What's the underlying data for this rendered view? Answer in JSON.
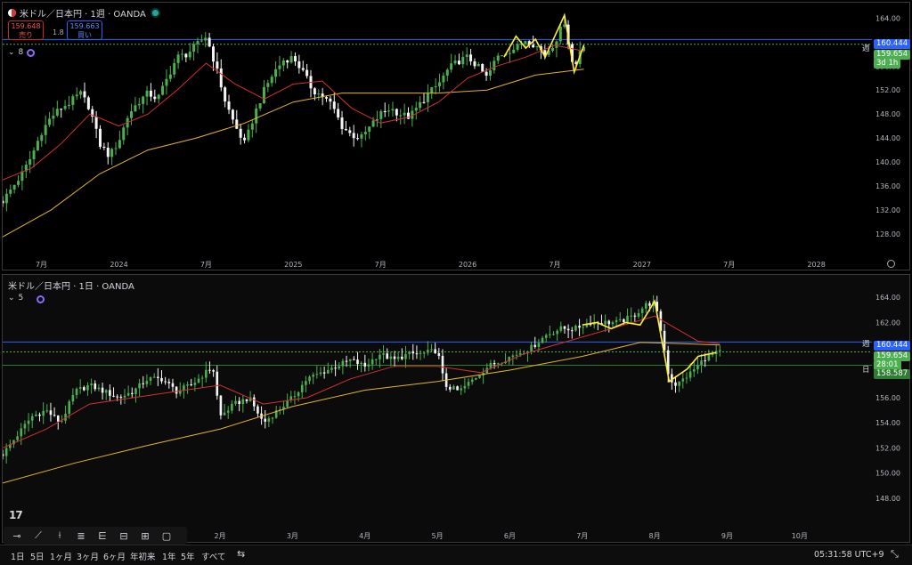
{
  "top_panel": {
    "title": "米ドル／日本円 · 1週 · OANDA",
    "sell_price": "159.648",
    "sell_label": "売り",
    "buy_price": "159.663",
    "buy_label": "買い",
    "spread": "1.8",
    "indicator_count": "8",
    "weekly_level_tag": "週",
    "weekly_level": "160.444",
    "current_price": "159.654",
    "countdown": "3d 1h"
  },
  "bottom_panel": {
    "title": "米ドル／日本円 · 1日 · OANDA",
    "indicator_count": "5",
    "weekly_level_tag": "週",
    "weekly_level": "160.444",
    "current_price": "159.654",
    "countdown": "28:01",
    "daily_level_tag": "日",
    "daily_level": "158.587"
  },
  "bottom_bar": {
    "timeframes": [
      "1日",
      "5日",
      "1ヶ月",
      "3ヶ月",
      "6ヶ月",
      "年初来",
      "1年",
      "5年",
      "すべて"
    ],
    "clock": "05:31:58 UTC+9"
  },
  "tools": [
    "cursor-line",
    "trend-line",
    "vertical-line",
    "fib-retracement",
    "fib-extension",
    "fib-channel",
    "grid",
    "rectangle"
  ],
  "colors": {
    "up": "#4caf50",
    "down": "#f5f5f5",
    "ma_fast": "#d32f2f",
    "ma_slow": "#e6b422",
    "level": "#2962ff",
    "zigzag": "#ffeb3b",
    "price_tag": "#4caf50"
  },
  "chart_data": [
    {
      "type": "candlestick",
      "title": "米ドル／日本円 · 1週 · OANDA",
      "ylim": [
        125,
        166
      ],
      "y_ticks": [
        128,
        132,
        136,
        140,
        144,
        148,
        152,
        156,
        160,
        164
      ],
      "x_ticks": [
        {
          "label": "7月",
          "t": 0.08
        },
        {
          "label": "2024",
          "t": 0.24
        },
        {
          "label": "7月",
          "t": 0.42
        },
        {
          "label": "2025",
          "t": 0.6
        },
        {
          "label": "7月",
          "t": 0.78
        },
        {
          "label": "2026",
          "t": 0.96
        },
        {
          "label": "7月",
          "t": 1.14
        },
        {
          "label": "2027",
          "t": 1.32
        },
        {
          "label": "7月",
          "t": 1.5
        },
        {
          "label": "2028",
          "t": 1.68
        }
      ],
      "t_range": [
        0,
        1.78
      ],
      "close_path": [
        [
          0.0,
          133.5
        ],
        [
          0.04,
          138
        ],
        [
          0.06,
          141
        ],
        [
          0.08,
          145
        ],
        [
          0.1,
          147.5
        ],
        [
          0.12,
          149
        ],
        [
          0.14,
          150
        ],
        [
          0.16,
          151.5
        ],
        [
          0.18,
          149
        ],
        [
          0.2,
          143
        ],
        [
          0.22,
          141
        ],
        [
          0.24,
          143.5
        ],
        [
          0.26,
          148
        ],
        [
          0.28,
          150
        ],
        [
          0.3,
          151.5
        ],
        [
          0.32,
          150.5
        ],
        [
          0.34,
          154
        ],
        [
          0.36,
          157.5
        ],
        [
          0.38,
          158
        ],
        [
          0.4,
          159.5
        ],
        [
          0.42,
          161
        ],
        [
          0.44,
          156
        ],
        [
          0.46,
          150
        ],
        [
          0.48,
          146
        ],
        [
          0.5,
          143
        ],
        [
          0.52,
          148
        ],
        [
          0.54,
          152
        ],
        [
          0.56,
          155
        ],
        [
          0.58,
          157
        ],
        [
          0.6,
          157.5
        ],
        [
          0.62,
          155
        ],
        [
          0.64,
          152
        ],
        [
          0.66,
          151
        ],
        [
          0.68,
          149.5
        ],
        [
          0.7,
          146
        ],
        [
          0.72,
          144.5
        ],
        [
          0.74,
          144
        ],
        [
          0.76,
          146
        ],
        [
          0.78,
          148
        ],
        [
          0.8,
          149
        ],
        [
          0.82,
          148
        ],
        [
          0.84,
          147.5
        ],
        [
          0.86,
          149.5
        ],
        [
          0.88,
          151.5
        ],
        [
          0.9,
          153
        ],
        [
          0.92,
          155.5
        ],
        [
          0.94,
          156.8
        ],
        [
          0.96,
          157.5
        ],
        [
          0.98,
          156
        ],
        [
          1.0,
          154
        ],
        [
          1.02,
          157.5
        ],
        [
          1.04,
          158.5
        ],
        [
          1.06,
          159
        ],
        [
          1.08,
          160.5
        ],
        [
          1.1,
          159.5
        ],
        [
          1.12,
          158
        ],
        [
          1.14,
          160
        ],
        [
          1.16,
          163.5
        ],
        [
          1.17,
          159
        ],
        [
          1.18,
          155
        ],
        [
          1.19,
          158.5
        ],
        [
          1.2,
          159.65
        ]
      ],
      "ma_fast": [
        [
          0.0,
          137
        ],
        [
          0.06,
          139
        ],
        [
          0.12,
          143
        ],
        [
          0.18,
          148
        ],
        [
          0.24,
          146
        ],
        [
          0.3,
          148
        ],
        [
          0.36,
          152
        ],
        [
          0.42,
          156.5
        ],
        [
          0.48,
          153
        ],
        [
          0.54,
          150.5
        ],
        [
          0.6,
          153
        ],
        [
          0.66,
          153.5
        ],
        [
          0.72,
          149
        ],
        [
          0.78,
          146.5
        ],
        [
          0.84,
          147.5
        ],
        [
          0.9,
          150
        ],
        [
          0.96,
          154
        ],
        [
          1.02,
          156
        ],
        [
          1.08,
          157.5
        ],
        [
          1.14,
          159.5
        ],
        [
          1.2,
          158.5
        ]
      ],
      "ma_slow": [
        [
          0.0,
          127.5
        ],
        [
          0.1,
          132
        ],
        [
          0.2,
          138
        ],
        [
          0.3,
          142
        ],
        [
          0.4,
          144
        ],
        [
          0.5,
          146.5
        ],
        [
          0.6,
          150
        ],
        [
          0.7,
          151.5
        ],
        [
          0.8,
          151.5
        ],
        [
          0.9,
          151.5
        ],
        [
          1.0,
          152
        ],
        [
          1.1,
          154.5
        ],
        [
          1.2,
          155.5
        ]
      ],
      "zigzag": [
        [
          1.035,
          157.5
        ],
        [
          1.06,
          161
        ],
        [
          1.08,
          159
        ],
        [
          1.1,
          160.5
        ],
        [
          1.12,
          157.5
        ],
        [
          1.16,
          164.5
        ],
        [
          1.18,
          155
        ],
        [
          1.2,
          159.5
        ]
      ],
      "levels": [
        {
          "value": 160.444,
          "color": "#2962ff"
        },
        {
          "value": 159.654,
          "color": "#4caf50",
          "dashed": true
        }
      ]
    },
    {
      "type": "candlestick",
      "title": "米ドル／日本円 · 1日 · OANDA",
      "ylim": [
        146.5,
        165.5
      ],
      "y_ticks": [
        148,
        150,
        152,
        154,
        156,
        158,
        160,
        162,
        164
      ],
      "x_ticks": [
        {
          "label": "2月",
          "t": 3.0
        },
        {
          "label": "3月",
          "t": 4.0
        },
        {
          "label": "4月",
          "t": 5.0
        },
        {
          "label": "5月",
          "t": 6.0
        },
        {
          "label": "6月",
          "t": 7.0
        },
        {
          "label": "7月",
          "t": 8.0
        },
        {
          "label": "8月",
          "t": 9.0
        },
        {
          "label": "9月",
          "t": 10.0
        },
        {
          "label": "10月",
          "t": 11.0
        }
      ],
      "t_range": [
        0,
        11.9
      ],
      "close_path": [
        [
          0.0,
          151.5
        ],
        [
          0.2,
          153
        ],
        [
          0.4,
          154.5
        ],
        [
          0.6,
          155
        ],
        [
          0.8,
          154
        ],
        [
          1.0,
          156.5
        ],
        [
          1.2,
          157
        ],
        [
          1.4,
          156.5
        ],
        [
          1.6,
          156
        ],
        [
          1.8,
          156.5
        ],
        [
          2.0,
          157.5
        ],
        [
          2.2,
          157.5
        ],
        [
          2.4,
          156.5
        ],
        [
          2.6,
          157
        ],
        [
          2.8,
          158
        ],
        [
          2.9,
          158.5
        ],
        [
          3.0,
          154.5
        ],
        [
          3.2,
          155.5
        ],
        [
          3.4,
          156
        ],
        [
          3.6,
          154
        ],
        [
          3.8,
          155
        ],
        [
          4.0,
          156
        ],
        [
          4.2,
          157.5
        ],
        [
          4.4,
          158
        ],
        [
          4.6,
          158.5
        ],
        [
          4.8,
          159
        ],
        [
          5.0,
          158.5
        ],
        [
          5.2,
          159.5
        ],
        [
          5.4,
          159
        ],
        [
          5.6,
          159.5
        ],
        [
          5.8,
          159.5
        ],
        [
          6.0,
          159.8
        ],
        [
          6.1,
          157
        ],
        [
          6.3,
          156.5
        ],
        [
          6.5,
          157.5
        ],
        [
          6.7,
          158.5
        ],
        [
          6.9,
          159
        ],
        [
          7.1,
          159.5
        ],
        [
          7.3,
          160
        ],
        [
          7.5,
          161
        ],
        [
          7.7,
          161.5
        ],
        [
          7.9,
          161.5
        ],
        [
          8.1,
          162
        ],
        [
          8.3,
          162
        ],
        [
          8.5,
          162
        ],
        [
          8.7,
          162.5
        ],
        [
          8.9,
          163.5
        ],
        [
          9.0,
          163.5
        ],
        [
          9.1,
          161
        ],
        [
          9.2,
          157.5
        ],
        [
          9.3,
          157
        ],
        [
          9.5,
          158
        ],
        [
          9.7,
          159.2
        ],
        [
          9.9,
          159.65
        ]
      ],
      "ma_fast": [
        [
          0.0,
          152
        ],
        [
          0.6,
          153.5
        ],
        [
          1.2,
          155.5
        ],
        [
          1.8,
          156
        ],
        [
          2.4,
          156.5
        ],
        [
          3.0,
          157
        ],
        [
          3.6,
          155.5
        ],
        [
          4.2,
          156
        ],
        [
          4.8,
          157.5
        ],
        [
          5.4,
          158.5
        ],
        [
          6.0,
          158.5
        ],
        [
          6.6,
          158
        ],
        [
          7.2,
          159.5
        ],
        [
          7.8,
          160.5
        ],
        [
          8.4,
          161.5
        ],
        [
          9.0,
          162.5
        ],
        [
          9.6,
          160.5
        ],
        [
          9.9,
          160.3
        ]
      ],
      "ma_slow": [
        [
          0.0,
          149.2
        ],
        [
          1.0,
          150.8
        ],
        [
          2.0,
          152.2
        ],
        [
          3.0,
          153.5
        ],
        [
          4.0,
          155.3
        ],
        [
          5.0,
          156.6
        ],
        [
          6.0,
          157.3
        ],
        [
          7.0,
          158.2
        ],
        [
          8.0,
          159.3
        ],
        [
          8.8,
          160.4
        ],
        [
          9.4,
          160.3
        ],
        [
          9.9,
          160.2
        ]
      ],
      "zigzag": [
        [
          8.0,
          161.8
        ],
        [
          8.2,
          162
        ],
        [
          8.4,
          161.5
        ],
        [
          8.6,
          162
        ],
        [
          8.8,
          161.8
        ],
        [
          9.0,
          163.7
        ],
        [
          9.2,
          157.3
        ],
        [
          9.45,
          158.3
        ],
        [
          9.6,
          159.3
        ],
        [
          9.85,
          159.6
        ]
      ],
      "levels": [
        {
          "value": 160.444,
          "color": "#2962ff"
        },
        {
          "value": 159.654,
          "color": "#4caf50",
          "dashed": true
        },
        {
          "value": 158.587,
          "color": "#2e7d32"
        }
      ]
    }
  ]
}
